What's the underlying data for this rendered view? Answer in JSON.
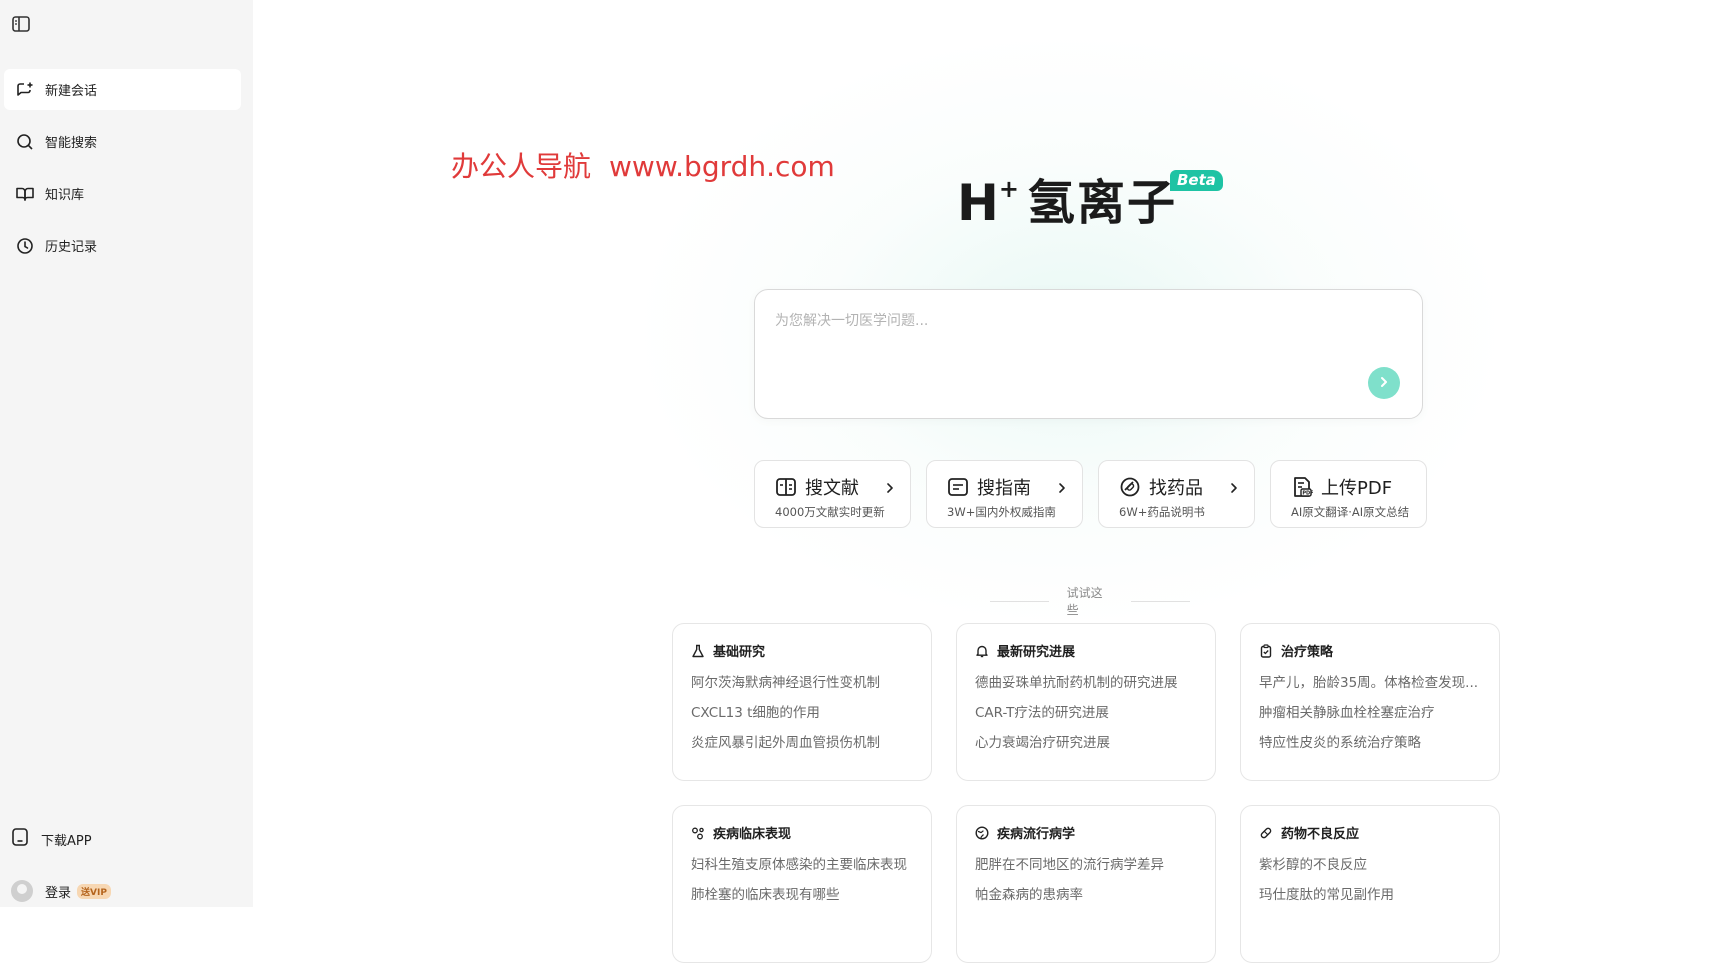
{
  "sidebar": {
    "toggle_icon": "sidebar-toggle-icon",
    "items": [
      {
        "label": "新建会话",
        "icon": "new-chat-icon"
      },
      {
        "label": "智能搜索",
        "icon": "search-icon"
      },
      {
        "label": "知识库",
        "icon": "book-icon"
      },
      {
        "label": "历史记录",
        "icon": "clock-icon"
      }
    ],
    "download_app": "下载APP",
    "login": "登录",
    "vip_badge": "送VIP"
  },
  "watermark": {
    "name": "办公人导航",
    "url": "www.bgrdh.com"
  },
  "brand": {
    "h": "H",
    "plus": "+",
    "name": "氢离子",
    "beta": "Beta",
    "accent": "#1ec3a4"
  },
  "search": {
    "placeholder": "为您解决一切医学问题..."
  },
  "tools": [
    {
      "title": "搜文献",
      "sub": "4000万文献实时更新",
      "icon": "literature-icon"
    },
    {
      "title": "搜指南",
      "sub": "3W+国内外权威指南",
      "icon": "guide-icon"
    },
    {
      "title": "找药品",
      "sub": "6W+药品说明书",
      "icon": "pill-icon"
    },
    {
      "title": "上传PDF",
      "sub": "AI原文翻译·AI原文总结",
      "icon": "pdf-icon"
    }
  ],
  "try_label": "试试这些",
  "cards": [
    {
      "title": "基础研究",
      "icon": "flask-icon",
      "questions": [
        "阿尔茨海默病神经退行性变机制",
        "CXCL13 t细胞的作用",
        "炎症风暴引起外周血管损伤机制"
      ]
    },
    {
      "title": "最新研究进展",
      "icon": "bell-icon",
      "questions": [
        "德曲妥珠单抗耐药机制的研究进展",
        "CAR-T疗法的研究进展",
        "心力衰竭治疗研究进展"
      ]
    },
    {
      "title": "治疗策略",
      "icon": "clipboard-icon",
      "questions": [
        "早产儿，胎龄35周。体格检查发现...",
        "肿瘤相关静脉血栓栓塞症治疗",
        "特应性皮炎的系统治疗策略"
      ]
    },
    {
      "title": "疾病临床表现",
      "icon": "nodes-icon",
      "questions": [
        "妇科生殖支原体感染的主要临床表现",
        "肺栓塞的临床表现有哪些"
      ]
    },
    {
      "title": "疾病流行病学",
      "icon": "globe-icon",
      "questions": [
        "肥胖在不同地区的流行病学差异",
        "帕金森病的患病率"
      ]
    },
    {
      "title": "药物不良反应",
      "icon": "capsule-icon",
      "questions": [
        "紫杉醇的不良反应",
        "玛仕度肽的常见副作用"
      ]
    }
  ]
}
